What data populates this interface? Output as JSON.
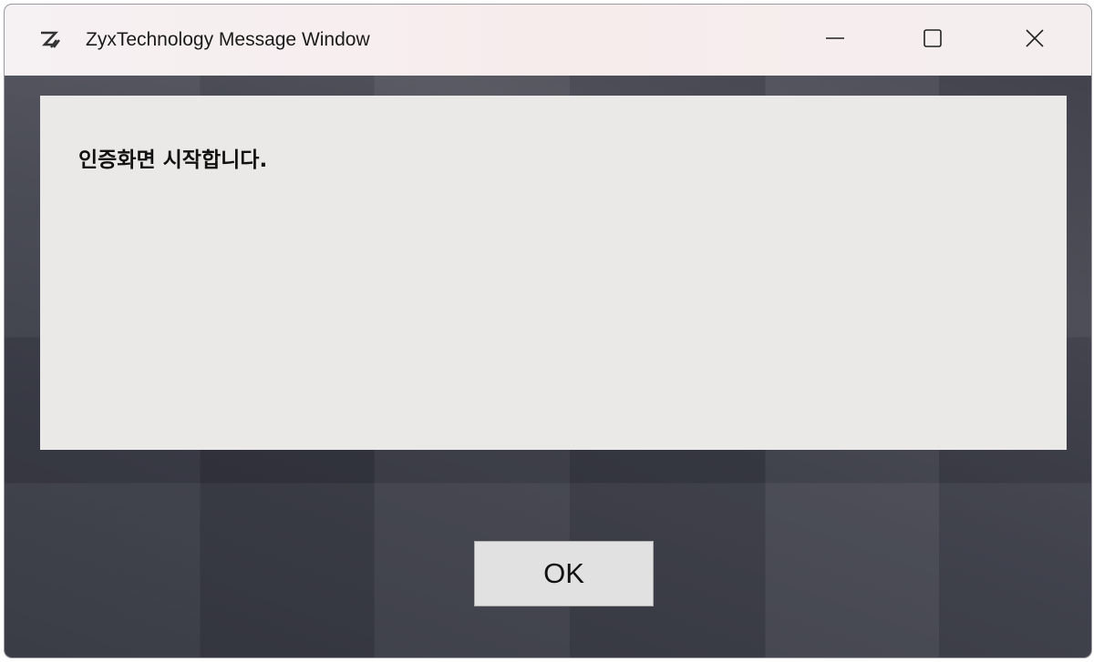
{
  "window": {
    "title": "ZyxTechnology Message Window",
    "logo_icon": "z-logo-icon",
    "controls": {
      "minimize_icon": "minimize-icon",
      "maximize_icon": "maximize-icon",
      "close_icon": "close-icon"
    }
  },
  "message": {
    "text": "인증화면 시작합니다."
  },
  "buttons": {
    "ok_label": "OK"
  },
  "colors": {
    "titlebar": "#f6f1f3",
    "panel": "#ebe9e7",
    "body": "#3a3c47",
    "button": "#e1e1e1"
  }
}
